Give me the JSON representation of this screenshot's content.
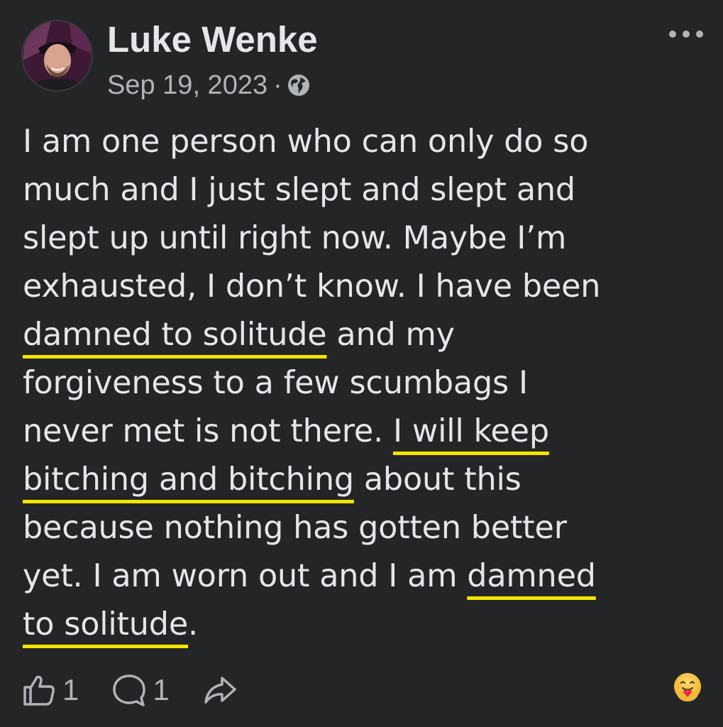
{
  "post": {
    "author": "Luke Wenke",
    "date": "Sep 19, 2023",
    "separator": "·",
    "privacy_icon": "globe-icon",
    "more_icon": "more-options-icon",
    "body_lines": [
      [
        {
          "t": "I am one person who can only do so",
          "u": false
        }
      ],
      [
        {
          "t": "much and I just slept and slept and",
          "u": false
        }
      ],
      [
        {
          "t": "slept up until right now.  Maybe I’m",
          "u": false
        }
      ],
      [
        {
          "t": "exhausted, I don’t know.  I have been",
          "u": false
        }
      ],
      [
        {
          "t": "damned to solitude",
          "u": true
        },
        {
          "t": " and my",
          "u": false
        }
      ],
      [
        {
          "t": "forgiveness to a few scumbags I",
          "u": false
        }
      ],
      [
        {
          "t": "never met is not there.  ",
          "u": false
        },
        {
          "t": "I will keep",
          "u": true
        }
      ],
      [
        {
          "t": "bitching and bitching",
          "u": true
        },
        {
          "t": " about this",
          "u": false
        }
      ],
      [
        {
          "t": "because nothing has gotten better",
          "u": false
        }
      ],
      [
        {
          "t": "yet.  I am worn out and I am ",
          "u": false
        },
        {
          "t": "damned",
          "u": true
        }
      ],
      [
        {
          "t": "to solitude",
          "u": true
        },
        {
          "t": ".",
          "u": false
        }
      ]
    ],
    "highlight_color": "#f5e400"
  },
  "actions": {
    "like": {
      "icon": "thumbs-up-icon",
      "count": "1"
    },
    "comment": {
      "icon": "comment-icon",
      "count": "1"
    },
    "share": {
      "icon": "share-icon"
    },
    "reaction": {
      "icon": "care-reaction-icon"
    }
  },
  "colors": {
    "background": "#242526",
    "text": "#e4e6eb",
    "secondary": "#b0b3b8"
  }
}
